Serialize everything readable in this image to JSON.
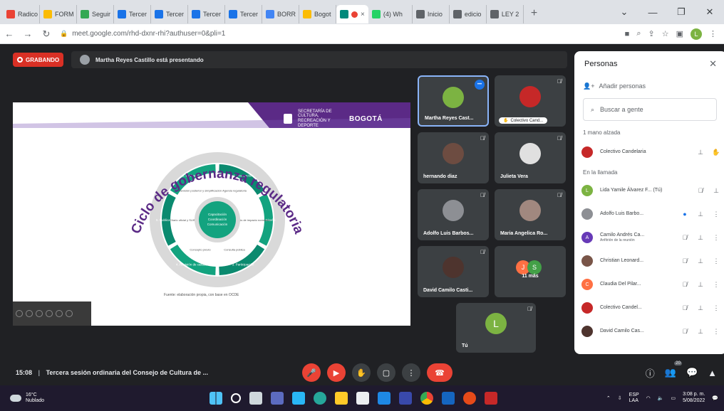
{
  "browser": {
    "tabs": [
      {
        "label": "Radico",
        "color": "#ea4335"
      },
      {
        "label": "FORM",
        "color": "#fbbc04"
      },
      {
        "label": "Seguir",
        "color": "#34a853"
      },
      {
        "label": "Tercer",
        "color": "#1a73e8"
      },
      {
        "label": "Tercer",
        "color": "#1a73e8"
      },
      {
        "label": "Tercer",
        "color": "#1a73e8"
      },
      {
        "label": "Tercer",
        "color": "#1a73e8"
      },
      {
        "label": "BORR",
        "color": "#4285f4"
      },
      {
        "label": "Bogot",
        "color": "#fbbc04"
      },
      {
        "label": "(4) Wh",
        "color": "#25d366"
      },
      {
        "label": "Inicio",
        "color": "#5f6368"
      },
      {
        "label": "edicio",
        "color": "#5f6368"
      },
      {
        "label": "LEY 2",
        "color": "#5f6368"
      }
    ],
    "active_tab_close": "×",
    "new_tab": "+",
    "url": "meet.google.com/rhd-dxnr-rhi?authuser=0&pli=1",
    "profile_initial": "L"
  },
  "meet": {
    "recording_label": "GRABANDO",
    "presenting_text": "Martha Reyes Castillo está presentando",
    "slide": {
      "title": "Ciclo de gobernanza regulatoria",
      "header_text": "SECRETARÍA DE CULTURA, RECREACIÓN Y DEPORTE",
      "brand": "BOGOTÁ",
      "center_text": [
        "Capacitación",
        "Coordinación",
        "Comunicación"
      ],
      "segments": [
        "1. Planeación",
        "2. Diseño",
        "3. Participación",
        "4. Revisión de calidad",
        "5. Publicación",
        "6. Evaluación"
      ],
      "inner_labels": [
        "Agenda regulatoria",
        "Análisis de impacto normativo",
        "Consulta pública",
        "Concepto previo",
        "Diario oficial y SUIN",
        "Revisión posterior y simplificación"
      ],
      "caption": "Fuente: elaboración propia, con base en OCDE"
    },
    "tiles": [
      {
        "name": "Martha Reyes Cast...",
        "color": "#7cb342"
      },
      {
        "name": "Colectivo Cand...",
        "color": "#c62828"
      },
      {
        "name": "hernando diaz",
        "color": "#6d4c41"
      },
      {
        "name": "Julieta Vera",
        "color": "#e0e0e0"
      },
      {
        "name": "Adolfo Luis Barbos...",
        "color": "#8d8f94"
      },
      {
        "name": "Maria Angelica Ro...",
        "color": "#a1887f"
      },
      {
        "name": "David Camilo Casti...",
        "color": "#4e342e"
      },
      {
        "name": "11 más",
        "color": "#ff7043"
      },
      {
        "name": "Tú",
        "color": "#7cb342",
        "initial": "L"
      }
    ],
    "more_initials": [
      "J",
      "S"
    ],
    "time": "15:08",
    "meeting_title": "Tercera sesión ordinaria del Consejo de Cultura de ...",
    "participants_count": "20"
  },
  "people_panel": {
    "title": "Personas",
    "add_people": "Añadir personas",
    "search_placeholder": "Buscar a gente",
    "raised_hands_section": "1 mano alzada",
    "in_call_section": "En la llamada",
    "raised": {
      "name": "Colectivo Candelaria",
      "color": "#c62828"
    },
    "people": [
      {
        "name": "Lida Yamile Álvarez F... (Tú)",
        "sub": "",
        "color": "#7cb342",
        "initial": "L"
      },
      {
        "name": "Adolfo Luis Barbo...",
        "sub": "",
        "color": "#8d8f94",
        "initial": ""
      },
      {
        "name": "Camilo Andrés Ca...",
        "sub": "Anfitrión de la reunión",
        "color": "#673ab7",
        "initial": "A"
      },
      {
        "name": "Christian Leonard...",
        "sub": "",
        "color": "#795548",
        "initial": ""
      },
      {
        "name": "Claudia Del Pilar...",
        "sub": "",
        "color": "#ff7043",
        "initial": "C"
      },
      {
        "name": "Colectivo Candel...",
        "sub": "",
        "color": "#c62828",
        "initial": ""
      },
      {
        "name": "David Camilo Cas...",
        "sub": "",
        "color": "#4e342e",
        "initial": ""
      }
    ]
  },
  "taskbar": {
    "temp": "16°C",
    "weather": "Nublado",
    "lang": "ESP",
    "lang2": "LAA",
    "time": "3:08 p. m.",
    "date": "5/08/2022"
  }
}
